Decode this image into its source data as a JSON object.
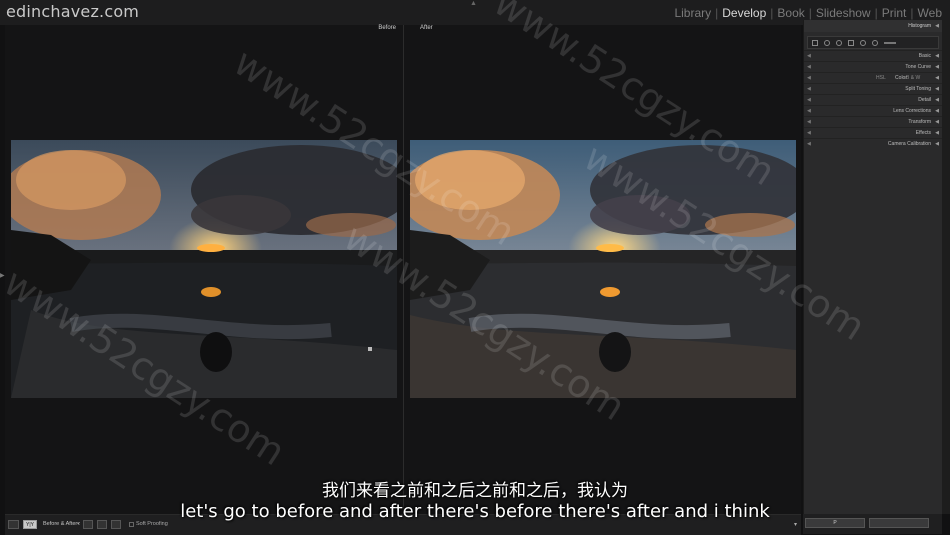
{
  "brand": "edinchavez.com",
  "modules": [
    {
      "label": "Library",
      "active": false
    },
    {
      "label": "Develop",
      "active": true
    },
    {
      "label": "Book",
      "active": false
    },
    {
      "label": "Slideshow",
      "active": false
    },
    {
      "label": "Print",
      "active": false
    },
    {
      "label": "Web",
      "active": false
    }
  ],
  "view": {
    "before_label": "Before",
    "after_label": "After"
  },
  "right_panel": {
    "histogram": "Histogram",
    "sections": {
      "basic": "Basic",
      "tone_curve": "Tone Curve",
      "hsl": "HSL",
      "color": "Color",
      "bw": "B & W",
      "split_toning": "Split Toning",
      "detail": "Detail",
      "lens_corrections": "Lens Corrections",
      "transform": "Transform",
      "effects": "Effects",
      "camera_calibration": "Camera Calibration"
    },
    "bottom_button": "P"
  },
  "toolbar": {
    "view_mode": "Y|Y",
    "before_after": "Before & After :",
    "soft_proofing": "Soft Proofing"
  },
  "watermark": "www.52cgzy.com",
  "subtitles": {
    "chinese": "我们来看之前和之后之前和之后，我认为",
    "english": "let's go to before and after there's before there's after and i think"
  },
  "colors": {
    "active_module": "#d8d8d8",
    "inactive_module": "#7a7a7a",
    "panel_bg": "#2a2a2b"
  }
}
